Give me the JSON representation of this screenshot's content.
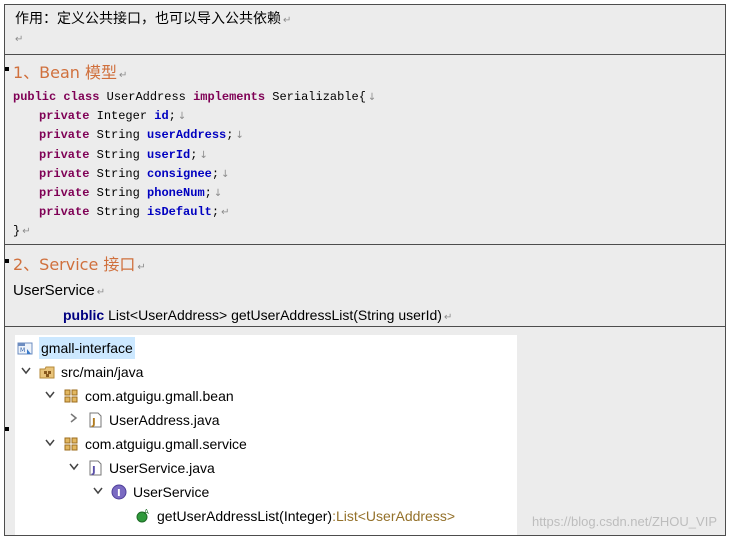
{
  "section0": {
    "text": "作用：定义公共接口，也可以导入公共依赖"
  },
  "section1": {
    "heading": "1、Bean 模型",
    "code": {
      "class_public": "public",
      "class_kw": "class",
      "class_name": "UserAddress",
      "implements_kw": "implements",
      "interface": "Serializable{",
      "fields": [
        {
          "mod": "private",
          "type": "Integer",
          "name": "id"
        },
        {
          "mod": "private",
          "type": "String",
          "name": "userAddress"
        },
        {
          "mod": "private",
          "type": "String",
          "name": "userId"
        },
        {
          "mod": "private",
          "type": "String",
          "name": "consignee"
        },
        {
          "mod": "private",
          "type": "String",
          "name": "phoneNum"
        },
        {
          "mod": "private",
          "type": "String",
          "name": "isDefault"
        }
      ],
      "close": "}"
    }
  },
  "section2": {
    "heading": "2、Service 接口",
    "service_name": "UserService",
    "method_public": "public",
    "method_signature": "List<UserAddress> getUserAddressList(String userId)"
  },
  "tree": {
    "project": "gmall-interface",
    "src": "src/main/java",
    "pkg_bean": "com.atguigu.gmall.bean",
    "file_bean": "UserAddress.java",
    "pkg_service": "com.atguigu.gmall.service",
    "file_service": "UserService.java",
    "interface": "UserService",
    "method": "getUserAddressList(Integer)",
    "method_sep": " : ",
    "method_type": "List<UserAddress>"
  },
  "watermark": "https://blog.csdn.net/ZHOU_VIP",
  "marks": {
    "paragraph": "↵",
    "line": "↓"
  },
  "colors": {
    "heading": "#d0703d",
    "keyword": "#7f0055",
    "field": "#0000c0",
    "cell_bg": "#ececec",
    "border": "#4d4d4d"
  }
}
